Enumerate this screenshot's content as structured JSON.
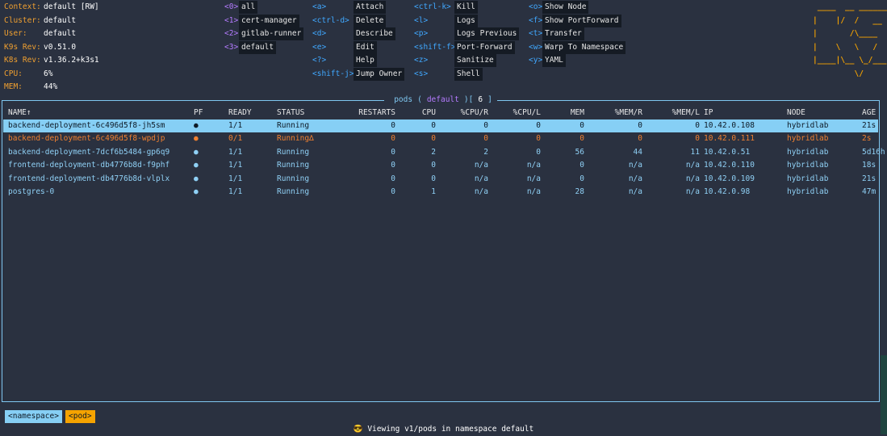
{
  "cluster_info": [
    {
      "label": "Context:",
      "value": "default [RW]"
    },
    {
      "label": "Cluster:",
      "value": "default"
    },
    {
      "label": "User:",
      "value": "default"
    },
    {
      "label": "K9s Rev:",
      "value": "v0.51.0"
    },
    {
      "label": "K8s Rev:",
      "value": "v1.36.2+k3s1"
    },
    {
      "label": "CPU:",
      "value": "6%"
    },
    {
      "label": "MEM:",
      "value": "44%"
    }
  ],
  "namespace_shortcuts": [
    {
      "key": "<0>",
      "label": "all"
    },
    {
      "key": "<1>",
      "label": "cert-manager"
    },
    {
      "key": "<2>",
      "label": "gitlab-runner"
    },
    {
      "key": "<3>",
      "label": "default"
    }
  ],
  "action_col1": [
    {
      "key": "<a>",
      "label": "Attach"
    },
    {
      "key": "<ctrl-d>",
      "label": "Delete"
    },
    {
      "key": "<d>",
      "label": "Describe"
    },
    {
      "key": "<e>",
      "label": "Edit"
    },
    {
      "key": "<?>",
      "label": "Help"
    },
    {
      "key": "<shift-j>",
      "label": "Jump Owner"
    }
  ],
  "action_col2": [
    {
      "key": "<ctrl-k>",
      "label": "Kill"
    },
    {
      "key": "<l>",
      "label": "Logs"
    },
    {
      "key": "<p>",
      "label": "Logs Previous"
    },
    {
      "key": "<shift-f>",
      "label": "Port-Forward"
    },
    {
      "key": "<z>",
      "label": "Sanitize"
    },
    {
      "key": "<s>",
      "label": "Shell"
    }
  ],
  "action_col3": [
    {
      "key": "<o>",
      "label": "Show Node"
    },
    {
      "key": "<f>",
      "label": "Show PortForward"
    },
    {
      "key": "<t>",
      "label": "Transfer"
    },
    {
      "key": "<w>",
      "label": "Warp To Namespace"
    },
    {
      "key": "<y>",
      "label": "YAML"
    }
  ],
  "logo_lines": [
    " ____  __ ________",
    "|    |/  /   __   \\",
    "|       /\\____    /",
    "|    \\   \\   /   /",
    "|____|\\__ \\_/___/",
    "         \\/"
  ],
  "frame_title": {
    "resource": "pods",
    "namespace": "default",
    "count": "6"
  },
  "columns": [
    "NAME↑",
    "PF",
    "READY",
    "STATUS",
    "RESTARTS",
    "CPU",
    "%CPU/R",
    "%CPU/L",
    "MEM",
    "%MEM/R",
    "%MEM/L",
    "IP",
    "NODE",
    "AGE"
  ],
  "rows": [
    {
      "state": "selected",
      "cells": [
        "backend-deployment-6c496d5f8-jh5sm",
        "●",
        "1/1",
        "Running",
        "0",
        "0",
        "0",
        "0",
        "0",
        "0",
        "0",
        "10.42.0.108",
        "hybridlab",
        "21s"
      ]
    },
    {
      "state": "warn",
      "cells": [
        "backend-deployment-6c496d5f8-wpdjp",
        "●",
        "0/1",
        "Running∆",
        "0",
        "0",
        "0",
        "0",
        "0",
        "0",
        "0",
        "10.42.0.111",
        "hybridlab",
        "2s"
      ]
    },
    {
      "state": "normal",
      "cells": [
        "backend-deployment-7dcf6b5484-gp6q9",
        "●",
        "1/1",
        "Running",
        "0",
        "2",
        "2",
        "0",
        "56",
        "44",
        "11",
        "10.42.0.51",
        "hybridlab",
        "5d16h"
      ]
    },
    {
      "state": "normal",
      "cells": [
        "frontend-deployment-db4776b8d-f9phf",
        "●",
        "1/1",
        "Running",
        "0",
        "0",
        "n/a",
        "n/a",
        "0",
        "n/a",
        "n/a",
        "10.42.0.110",
        "hybridlab",
        "18s"
      ]
    },
    {
      "state": "normal",
      "cells": [
        "frontend-deployment-db4776b8d-vlplx",
        "●",
        "1/1",
        "Running",
        "0",
        "0",
        "n/a",
        "n/a",
        "0",
        "n/a",
        "n/a",
        "10.42.0.109",
        "hybridlab",
        "21s"
      ]
    },
    {
      "state": "normal",
      "cells": [
        "postgres-0",
        "●",
        "1/1",
        "Running",
        "0",
        "1",
        "n/a",
        "n/a",
        "28",
        "n/a",
        "n/a",
        "10.42.0.98",
        "hybridlab",
        "47m"
      ]
    }
  ],
  "breadcrumbs": [
    "<namespace>",
    "<pod>"
  ],
  "flash": {
    "emoji": "😎",
    "message": "Viewing v1/pods in namespace default"
  },
  "colors": {
    "background": "#2a3140",
    "accent": "#86cff5",
    "warn": "#f08030",
    "logo": "#f5a300",
    "key": "#b57bff"
  }
}
